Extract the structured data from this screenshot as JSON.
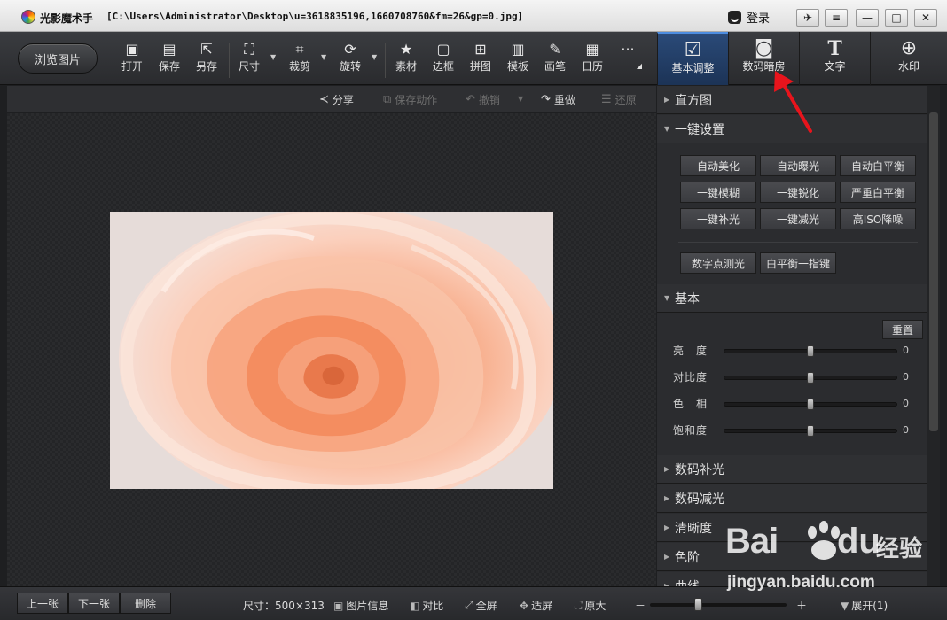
{
  "titlebar": {
    "app_name": "光影魔术手",
    "file_path": "[C:\\Users\\Administrator\\Desktop\\u=3618835196,1660708760&fm=26&gp=0.jpg]",
    "login_label": "登录",
    "login_icon": "user-face-icon",
    "controls": [
      "pin-icon",
      "menu-icon",
      "minimize-icon",
      "maximize-icon",
      "close-icon"
    ]
  },
  "toolbar": {
    "browse_label": "浏览图片",
    "tools": [
      {
        "label": "打开",
        "icon": "open-image-icon"
      },
      {
        "label": "保存",
        "icon": "save-icon"
      },
      {
        "label": "另存",
        "icon": "save-as-icon"
      },
      {
        "label": "尺寸",
        "icon": "resize-icon"
      },
      {
        "label": "裁剪",
        "icon": "crop-icon"
      },
      {
        "label": "旋转",
        "icon": "rotate-icon"
      },
      {
        "label": "素材",
        "icon": "material-icon"
      },
      {
        "label": "边框",
        "icon": "border-icon"
      },
      {
        "label": "拼图",
        "icon": "collage-icon"
      },
      {
        "label": "模板",
        "icon": "template-icon"
      },
      {
        "label": "画笔",
        "icon": "brush-icon"
      },
      {
        "label": "日历",
        "icon": "calendar-icon"
      }
    ],
    "more_label": "···",
    "right_tabs": [
      {
        "label": "基本调整",
        "icon": "adjust-icon"
      },
      {
        "label": "数码暗房",
        "icon": "camera-icon"
      },
      {
        "label": "文字",
        "icon": "text-icon"
      },
      {
        "label": "水印",
        "icon": "watermark-icon"
      }
    ]
  },
  "actionbar": {
    "share": "分享",
    "save_action": "保存动作",
    "undo": "撤销",
    "redo": "重做",
    "restore": "还原"
  },
  "panel": {
    "histogram": "直方图",
    "one_click": "一键设置",
    "one_click_buttons": [
      "自动美化",
      "自动曝光",
      "自动白平衡",
      "一键模糊",
      "一键锐化",
      "严重白平衡",
      "一键补光",
      "一键减光",
      "高ISO降噪"
    ],
    "extra_buttons": [
      "数字点测光",
      "白平衡一指键"
    ],
    "basic": "基本",
    "reset": "重置",
    "sliders": [
      {
        "label": "亮　度",
        "value": 0
      },
      {
        "label": "对比度",
        "value": 0
      },
      {
        "label": "色　相",
        "value": 0
      },
      {
        "label": "饱和度",
        "value": 0
      }
    ],
    "sections": [
      "数码补光",
      "数码减光",
      "清晰度",
      "色阶",
      "曲线"
    ]
  },
  "status": {
    "prev": "上一张",
    "next": "下一张",
    "delete": "删除",
    "size": "尺寸：500×313",
    "info": "图片信息",
    "compare": "对比",
    "fullscreen": "全屏",
    "fit": "适屏",
    "original": "原大",
    "zoom_minus": "－",
    "zoom_plus": "＋",
    "expand": "展开(1)"
  },
  "watermark": {
    "brand_left": "Bai",
    "brand_right": "du",
    "brand_cn": "经验",
    "url": "jingyan.baidu.com"
  },
  "colors": {
    "active_tab": "#2a4a78",
    "annotation_arrow": "#e8141c"
  }
}
